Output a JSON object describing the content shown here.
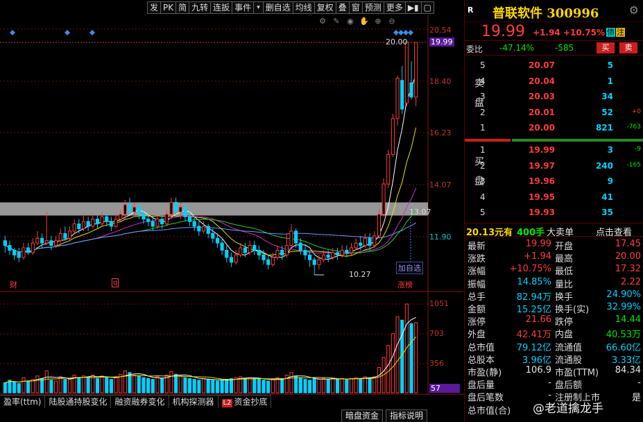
{
  "toolbar": [
    "发",
    "PK",
    "简",
    "九转",
    "连扳",
    "事件",
    "▾",
    "删自选",
    "均线",
    "复权",
    "叠",
    "窗",
    "预测",
    "更多",
    "▶▮",
    "▢"
  ],
  "tool_icons": [
    "gear-small-icon",
    "pen-icon",
    "eye-icon",
    "hand-icon",
    "zoom-in-icon",
    "zoom-out-icon"
  ],
  "chart_data": {
    "type": "candlestick",
    "price_axis": {
      "ylim": [
        10.27,
        20.54
      ],
      "ticks": [
        "20.54",
        "18.40",
        "16.23",
        "14.07",
        "11.90"
      ],
      "current": "19.99",
      "high_label": "20.00",
      "low_label": "10.27",
      "mid_label": "13.07"
    },
    "volume_axis": {
      "ylim": [
        0,
        1100
      ],
      "ticks": [
        "1051",
        "703",
        "356",
        "57"
      ]
    },
    "candles": [
      [
        11.7,
        11.5,
        11.9,
        11.2
      ],
      [
        11.5,
        11.3,
        11.7,
        11.1
      ],
      [
        11.3,
        11.1,
        11.4,
        10.9
      ],
      [
        11.2,
        11.0,
        11.4,
        10.8
      ],
      [
        11.0,
        11.4,
        11.6,
        10.9
      ],
      [
        11.4,
        11.2,
        11.6,
        11.1
      ],
      [
        11.2,
        11.6,
        11.8,
        11.1
      ],
      [
        11.6,
        11.8,
        12.1,
        11.5
      ],
      [
        11.8,
        11.6,
        12.0,
        11.4
      ],
      [
        11.6,
        11.7,
        12.9,
        11.5
      ],
      [
        11.7,
        11.5,
        11.9,
        11.3
      ],
      [
        11.5,
        11.7,
        11.9,
        11.4
      ],
      [
        11.7,
        12.0,
        12.2,
        11.6
      ],
      [
        12.0,
        11.8,
        12.3,
        11.7
      ],
      [
        11.8,
        12.1,
        12.3,
        11.7
      ],
      [
        12.1,
        12.4,
        12.6,
        12.0
      ],
      [
        12.4,
        12.2,
        12.6,
        12.0
      ],
      [
        12.2,
        12.5,
        12.8,
        12.1
      ],
      [
        12.5,
        12.3,
        12.7,
        12.1
      ],
      [
        12.3,
        12.6,
        12.8,
        12.2
      ],
      [
        12.6,
        12.4,
        12.8,
        12.2
      ],
      [
        12.4,
        12.7,
        12.9,
        12.3
      ],
      [
        12.7,
        12.5,
        12.9,
        12.3
      ],
      [
        12.5,
        12.3,
        12.7,
        12.1
      ],
      [
        12.3,
        12.6,
        12.8,
        12.2
      ],
      [
        12.6,
        12.8,
        13.0,
        12.5
      ],
      [
        12.8,
        13.2,
        13.4,
        12.6
      ],
      [
        13.2,
        12.9,
        13.5,
        12.8
      ],
      [
        12.9,
        13.1,
        13.3,
        12.7
      ],
      [
        13.1,
        12.8,
        13.3,
        12.6
      ],
      [
        12.8,
        12.6,
        13.0,
        12.4
      ],
      [
        12.6,
        12.5,
        12.8,
        12.3
      ],
      [
        12.5,
        12.3,
        12.7,
        12.1
      ],
      [
        12.3,
        12.6,
        12.8,
        12.2
      ],
      [
        12.6,
        12.4,
        12.8,
        12.2
      ],
      [
        12.4,
        12.8,
        13.0,
        12.3
      ],
      [
        12.8,
        13.3,
        13.5,
        12.6
      ],
      [
        13.3,
        12.9,
        13.5,
        12.7
      ],
      [
        12.9,
        13.1,
        13.3,
        12.6
      ],
      [
        13.1,
        12.7,
        13.2,
        12.5
      ],
      [
        12.7,
        12.5,
        12.9,
        12.3
      ],
      [
        12.5,
        12.3,
        12.7,
        12.1
      ],
      [
        12.3,
        12.1,
        12.5,
        11.9
      ],
      [
        12.1,
        12.3,
        12.5,
        12.0
      ],
      [
        12.3,
        12.0,
        12.4,
        11.8
      ],
      [
        12.0,
        11.8,
        12.2,
        11.6
      ],
      [
        11.8,
        11.6,
        12.0,
        11.4
      ],
      [
        11.6,
        11.3,
        11.8,
        11.1
      ],
      [
        11.3,
        11.0,
        11.5,
        10.8
      ],
      [
        11.0,
        10.8,
        11.2,
        10.6
      ],
      [
        10.8,
        11.1,
        11.3,
        10.7
      ],
      [
        11.1,
        11.4,
        11.6,
        11.0
      ],
      [
        11.4,
        11.2,
        11.6,
        11.0
      ],
      [
        11.2,
        11.5,
        11.7,
        11.1
      ],
      [
        11.5,
        11.3,
        11.7,
        11.1
      ],
      [
        11.3,
        11.1,
        11.5,
        10.9
      ],
      [
        11.1,
        10.9,
        11.3,
        10.7
      ],
      [
        10.9,
        10.7,
        11.1,
        10.5
      ],
      [
        10.7,
        11.0,
        11.2,
        10.6
      ],
      [
        11.0,
        11.3,
        11.5,
        10.9
      ],
      [
        11.3,
        11.1,
        11.5,
        10.9
      ],
      [
        11.1,
        11.5,
        12.0,
        11.0
      ],
      [
        11.5,
        12.1,
        12.4,
        11.4
      ],
      [
        12.1,
        11.6,
        12.2,
        11.4
      ],
      [
        11.6,
        11.3,
        11.8,
        11.1
      ],
      [
        11.3,
        11.1,
        11.5,
        10.9
      ],
      [
        11.1,
        10.9,
        11.3,
        10.6
      ],
      [
        10.9,
        10.7,
        11.0,
        10.27
      ],
      [
        10.7,
        10.9,
        11.1,
        10.5
      ],
      [
        10.9,
        11.1,
        11.3,
        10.8
      ],
      [
        11.1,
        11.0,
        11.3,
        10.8
      ],
      [
        11.0,
        11.2,
        11.4,
        10.9
      ],
      [
        11.2,
        11.1,
        11.4,
        10.9
      ],
      [
        11.1,
        11.3,
        11.5,
        11.0
      ],
      [
        11.3,
        11.2,
        11.5,
        11.0
      ],
      [
        11.2,
        11.4,
        11.6,
        11.1
      ],
      [
        11.4,
        11.6,
        11.8,
        11.3
      ],
      [
        11.6,
        11.5,
        11.9,
        11.3
      ],
      [
        11.5,
        11.8,
        12.0,
        11.4
      ],
      [
        11.8,
        11.5,
        12.0,
        11.3
      ],
      [
        11.5,
        11.9,
        12.1,
        11.4
      ],
      [
        11.9,
        12.8,
        13.0,
        11.8
      ],
      [
        12.8,
        14.07,
        14.3,
        12.7
      ],
      [
        14.07,
        15.3,
        15.5,
        13.9
      ],
      [
        15.3,
        16.8,
        17.0,
        15.2
      ],
      [
        16.8,
        18.49,
        18.6,
        16.5
      ],
      [
        18.4,
        17.2,
        19.0,
        17.0
      ],
      [
        17.45,
        20.0,
        20.0,
        17.32
      ],
      [
        18.3,
        17.7,
        19.2,
        17.6
      ],
      [
        17.7,
        19.99,
        20.0,
        17.32
      ]
    ],
    "volumes": [
      120,
      150,
      130,
      110,
      180,
      140,
      160,
      200,
      170,
      260,
      150,
      140,
      190,
      160,
      170,
      210,
      180,
      200,
      190,
      210,
      170,
      200,
      180,
      160,
      190,
      220,
      260,
      240,
      210,
      200,
      180,
      170,
      160,
      190,
      170,
      210,
      250,
      220,
      200,
      180,
      170,
      160,
      150,
      170,
      160,
      150,
      140,
      150,
      160,
      170,
      180,
      190,
      170,
      180,
      170,
      160,
      150,
      140,
      160,
      180,
      170,
      210,
      240,
      200,
      180,
      160,
      150,
      170,
      160,
      170,
      160,
      170,
      160,
      170,
      160,
      170,
      180,
      170,
      190,
      180,
      190,
      300,
      420,
      560,
      700,
      900,
      860,
      1051,
      820,
      830
    ],
    "ma_colors": [
      "#ffffff",
      "#e6e600",
      "#c832c8",
      "#32c832",
      "#6a9aff"
    ]
  },
  "labels": {
    "cai": "财",
    "q": "q",
    "add_fav": "加自选",
    "zhang_bang": "涨榜"
  },
  "bottom_tabs": [
    "盈率(ttm)",
    "陆股通持股变化",
    "融资融券变化",
    "机构探测器",
    "资金抄底"
  ],
  "bottom_tab_badge": "L2",
  "bottom_buttons": [
    "暗盘资金",
    "指标说明"
  ],
  "quote": {
    "r_badge": "R",
    "name": "普联软件",
    "code": "300996",
    "price": "19.99",
    "change": "+1.94",
    "change_pct": "+10.75%",
    "badge1": "债",
    "badge2": "注",
    "wb_label": "委比",
    "wb_pct": "-47.14%",
    "wb_diff": "-585",
    "buy_btn": "买",
    "sell_btn": "卖",
    "sell_label": "卖盘",
    "buy_label": "买盘",
    "asks": [
      {
        "lvl": "5",
        "p": "20.07",
        "v": "5",
        "d": ""
      },
      {
        "lvl": "4",
        "p": "20.04",
        "v": "1",
        "d": ""
      },
      {
        "lvl": "3",
        "p": "20.03",
        "v": "34",
        "d": ""
      },
      {
        "lvl": "2",
        "p": "20.01",
        "v": "52",
        "d": "+0"
      },
      {
        "lvl": "1",
        "p": "20.00",
        "v": "821",
        "d": "-763"
      }
    ],
    "bids": [
      {
        "lvl": "1",
        "p": "19.99",
        "v": "3",
        "d": "-9"
      },
      {
        "lvl": "2",
        "p": "19.97",
        "v": "240",
        "d": "-165"
      },
      {
        "lvl": "3",
        "p": "19.96",
        "v": "9",
        "d": ""
      },
      {
        "lvl": "4",
        "p": "19.95",
        "v": "41",
        "d": ""
      },
      {
        "lvl": "5",
        "p": "19.93",
        "v": "35",
        "d": ""
      }
    ],
    "big_order": {
      "price": "20.13元有",
      "qty": "400手",
      "label": "大卖单",
      "link": "点击查看"
    },
    "stats": [
      {
        "k1": "最新",
        "v1": "19.99",
        "c1": "red",
        "k2": "开盘",
        "v2": "17.45",
        "c2": "red"
      },
      {
        "k1": "涨跌",
        "v1": "+1.94",
        "c1": "red",
        "k2": "最高",
        "v2": "20.00",
        "c2": "red"
      },
      {
        "k1": "涨幅",
        "v1": "+10.75%",
        "c1": "red",
        "k2": "最低",
        "v2": "17.32",
        "c2": "red"
      },
      {
        "k1": "振幅",
        "v1": "14.85%",
        "c1": "cyan",
        "k2": "量比",
        "v2": "2.22",
        "c2": "red"
      },
      {
        "k1": "总手",
        "v1": "82.94万",
        "c1": "cyan",
        "k2": "换手",
        "v2": "24.90%",
        "c2": "cyan"
      },
      {
        "k1": "金额",
        "v1": "15.25亿",
        "c1": "cyan",
        "k2": "换手(实)",
        "v2": "32.99%",
        "c2": "cyan"
      },
      {
        "k1": "涨停",
        "v1": "21.66",
        "c1": "red",
        "k2": "跌停",
        "v2": "14.44",
        "c2": "grn"
      },
      {
        "k1": "外盘",
        "v1": "42.41万",
        "c1": "red",
        "k2": "内盘",
        "v2": "40.53万",
        "c2": "grn"
      },
      {
        "k1": "总市值",
        "v1": "79.12亿",
        "c1": "cyan",
        "k2": "流通值",
        "v2": "66.60亿",
        "c2": "cyan"
      },
      {
        "k1": "总股本",
        "v1": "3.96亿",
        "c1": "cyan",
        "k2": "流通股",
        "v2": "3.33亿",
        "c2": "cyan"
      },
      {
        "k1": "市盈(静)",
        "v1": "106.9",
        "c1": "white",
        "k2": "市盈(TTM)",
        "v2": "84.34",
        "c2": "white"
      },
      {
        "k1": "盘后量",
        "v1": "-",
        "c1": "white",
        "k2": "盘后额",
        "v2": "-",
        "c2": "white"
      },
      {
        "k1": "盘后笔数",
        "v1": "-",
        "c1": "white",
        "k2": "注册制上市",
        "v2": "是",
        "c2": "white"
      },
      {
        "k1": "总市值(合)",
        "v1": "",
        "c1": "white",
        "k2": "",
        "v2": "",
        "c2": "white"
      }
    ],
    "watermark": "@老道擒龙手"
  },
  "colors": {
    "up": "#ff3c3c",
    "down": "#00d2ff",
    "band": "#c8c8c8"
  }
}
